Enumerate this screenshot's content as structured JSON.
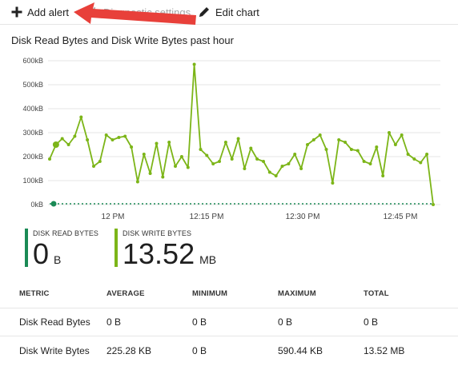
{
  "toolbar": {
    "add_alert": "Add alert",
    "diagnostic_settings": "Diagnostic settings",
    "edit_chart": "Edit chart"
  },
  "chart_data": {
    "type": "line",
    "title": "Disk Read Bytes and Disk Write Bytes past hour",
    "y_ticks": [
      "600kB",
      "500kB",
      "400kB",
      "300kB",
      "200kB",
      "100kB",
      "0kB"
    ],
    "x_ticks": [
      "12 PM",
      "12:15 PM",
      "12:30 PM",
      "12:45 PM"
    ],
    "ylim": [
      0,
      600
    ],
    "yunit": "kB",
    "grid": true,
    "series": [
      {
        "name": "Disk Write Bytes",
        "color": "#7cb518",
        "values": [
          190,
          250,
          275,
          250,
          285,
          365,
          270,
          160,
          180,
          290,
          270,
          280,
          285,
          240,
          95,
          210,
          130,
          255,
          115,
          260,
          160,
          200,
          155,
          585,
          230,
          205,
          170,
          180,
          260,
          190,
          275,
          150,
          235,
          190,
          180,
          135,
          120,
          160,
          170,
          210,
          150,
          250,
          270,
          290,
          230,
          90,
          270,
          260,
          230,
          225,
          180,
          170,
          240,
          120,
          300,
          250,
          290,
          210,
          190,
          175,
          210,
          0
        ]
      },
      {
        "name": "Disk Read Bytes",
        "color": "#1a8a55",
        "values": [
          0,
          0,
          0,
          0,
          0,
          0,
          0,
          0,
          0,
          0,
          0,
          0,
          0,
          0,
          0,
          0,
          0,
          0,
          0,
          0,
          0,
          0,
          0,
          0,
          0,
          0,
          0,
          0,
          0,
          0,
          0,
          0,
          0,
          0,
          0,
          0,
          0,
          0,
          0,
          0,
          0,
          0,
          0,
          0,
          0,
          0,
          0,
          0,
          0,
          0,
          0,
          0,
          0,
          0,
          0,
          0,
          0,
          0,
          0,
          0,
          0,
          0
        ]
      }
    ]
  },
  "tiles": {
    "read": {
      "label": "DISK READ BYTES",
      "value": "0",
      "unit": "B",
      "color": "#1a8a55"
    },
    "write": {
      "label": "DISK WRITE BYTES",
      "value": "13.52",
      "unit": "MB",
      "color": "#7cb518"
    }
  },
  "table": {
    "headers": [
      "METRIC",
      "AVERAGE",
      "MINIMUM",
      "MAXIMUM",
      "TOTAL"
    ],
    "rows": [
      [
        "Disk Read Bytes",
        "0 B",
        "0 B",
        "0 B",
        "0 B"
      ],
      [
        "Disk Write Bytes",
        "225.28 KB",
        "0 B",
        "590.44 KB",
        "13.52 MB"
      ]
    ]
  },
  "colors": {
    "annotation_arrow": "#e8403a"
  }
}
